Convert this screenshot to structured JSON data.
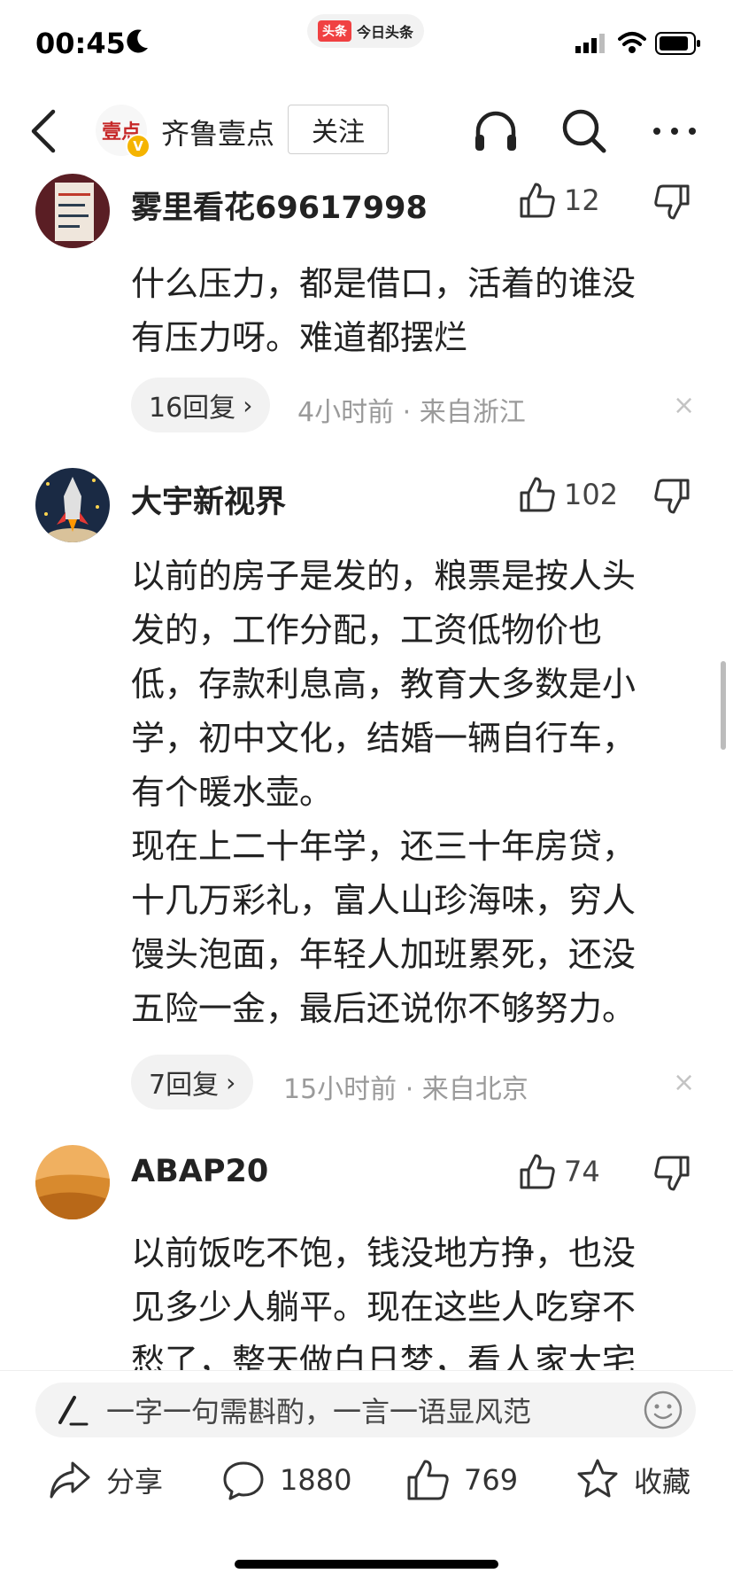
{
  "status_bar": {
    "time": "00:45",
    "app_badge": "头条",
    "app_name": "今日头条"
  },
  "nav": {
    "logo_text": "壹点",
    "verify_mark": "V",
    "source_name": "齐鲁壹点",
    "follow_label": "关注",
    "icons": [
      "back-icon",
      "headphones-icon",
      "search-icon",
      "more-icon"
    ]
  },
  "comments": [
    {
      "username": "雾里看花69617998",
      "likes": "12",
      "text": [
        "什么压力，都是借口，活着的谁没",
        "有压力呀。难道都摆烂"
      ],
      "replies": "16回复",
      "time": "4小时前",
      "location": "来自浙江"
    },
    {
      "username": "大宇新视界",
      "likes": "102",
      "text": [
        "以前的房子是发的，粮票是按人头",
        "发的，工作分配，工资低物价也",
        "低，存款利息高，教育大多数是小",
        "学，初中文化，结婚一辆自行车，",
        "有个暖水壶。",
        "现在上二十年学，还三十年房贷，",
        "十几万彩礼，富人山珍海味，穷人",
        "馒头泡面，年轻人加班累死，还没",
        "五险一金，最后还说你不够努力。"
      ],
      "replies": "7回复",
      "time": "15小时前",
      "location": "来自北京"
    },
    {
      "username": "ABAP20",
      "likes": "74",
      "text": [
        "以前饭吃不饱，钱没地方挣，也没",
        "见多少人躺平。现在这些人吃穿不",
        "愁了，整天做白日梦，看人家大宅"
      ]
    }
  ],
  "bottom": {
    "input_placeholder": "一字一句需斟酌，一言一语显风范",
    "share_label": "分享",
    "comment_count": "1880",
    "like_count": "769",
    "favorite_label": "收藏"
  },
  "colors": {
    "accent_red": "#f04142",
    "meta_gray": "#9a9a9a",
    "pill_bg": "#f2f2f2"
  },
  "separator": " · "
}
